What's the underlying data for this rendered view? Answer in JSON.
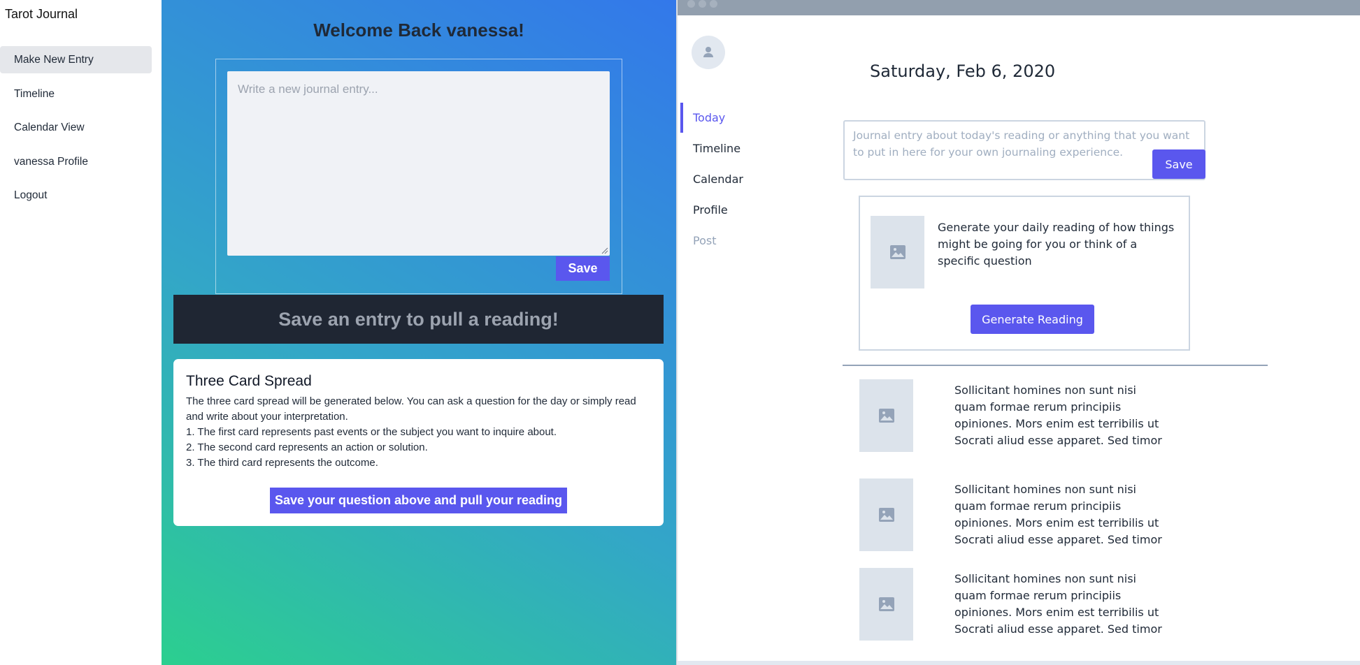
{
  "app": {
    "title": "Tarot Journal",
    "nav": [
      {
        "label": "Make New Entry",
        "active": true
      },
      {
        "label": "Timeline"
      },
      {
        "label": "Calendar View"
      },
      {
        "label": "vanessa Profile"
      },
      {
        "label": "Logout"
      }
    ]
  },
  "main": {
    "welcome": "Welcome Back vanessa!",
    "entry_placeholder": "Write a new journal entry...",
    "save_label": "Save",
    "banner": "Save an entry to pull a reading!",
    "spread": {
      "title": "Three Card Spread",
      "description": "The three card spread will be generated below. You can ask a question for the day or simply read and write about your interpretation.",
      "items": [
        "1. The first card represents past events or the subject you want to inquire about.",
        "2. The second card represents an action or solution.",
        "3. The third card represents the outcome."
      ],
      "button": "Save your question above and pull your reading"
    }
  },
  "wireframe": {
    "date": "Saturday, Feb 6, 2020",
    "nav": [
      {
        "label": "Today",
        "state": "active"
      },
      {
        "label": "Timeline",
        "state": "normal"
      },
      {
        "label": "Calendar",
        "state": "normal"
      },
      {
        "label": "Profile",
        "state": "normal"
      },
      {
        "label": "Post",
        "state": "muted"
      }
    ],
    "journal_placeholder": "Journal entry about today's reading or anything that you want to put in here for your own journaling experience.",
    "save_label": "Save",
    "reading_prompt": "Generate your daily reading of how things might be going for you or think of a specific question",
    "generate_label": "Generate Reading",
    "items": [
      {
        "text": "Sollicitant homines non sunt nisi quam formae rerum principiis opiniones. Mors enim est terribilis ut Socrati aliud esse apparet. Sed timor"
      },
      {
        "text": "Sollicitant homines non sunt nisi quam formae rerum principiis opiniones. Mors enim est terribilis ut Socrati aliud esse apparet. Sed timor"
      },
      {
        "text": "Sollicitant homines non sunt nisi quam formae rerum principiis opiniones. Mors enim est terribilis ut Socrati aliud esse apparet. Sed timor"
      }
    ]
  }
}
